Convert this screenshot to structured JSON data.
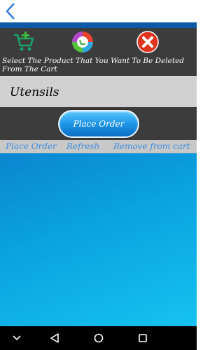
{
  "header": {
    "back_icon": "back-arrow-icon",
    "accent": "#0d5aa7"
  },
  "toolbar": {
    "icons": [
      "add-to-cart-icon",
      "refresh-circle-icon",
      "close-circle-icon"
    ]
  },
  "instruction": "Select The Product That You Want To Be Deleted From The Cart",
  "product": {
    "name": "Utensils"
  },
  "order": {
    "button_label": "Place Order"
  },
  "links": {
    "place_order": "Place Order",
    "refresh": "Refresh",
    "remove": "Remove from cart"
  },
  "navigation": {
    "icons": [
      "chevron-down-icon",
      "back-triangle-icon",
      "home-circle-icon",
      "recents-square-icon"
    ]
  }
}
